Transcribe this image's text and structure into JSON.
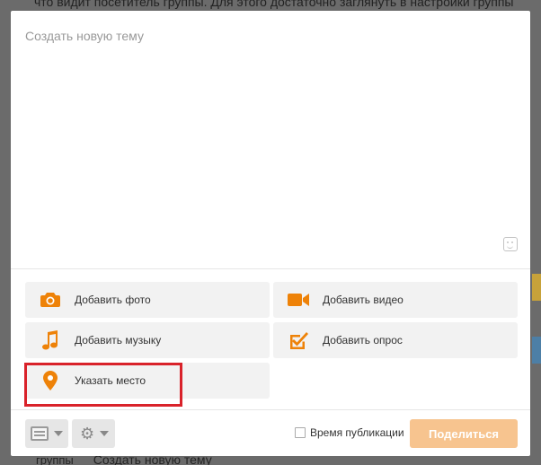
{
  "background": {
    "top_text": "что видит посетитель группы. Для этого достаточно заглянуть в настройки группы",
    "bottom_text_left": "группы",
    "bottom_text_right": "Создать новую тему"
  },
  "editor": {
    "placeholder": "Создать новую тему",
    "emoji_icon": "smile-icon"
  },
  "attachments": [
    {
      "label": "Добавить фото",
      "icon": "camera-icon"
    },
    {
      "label": "Добавить видео",
      "icon": "video-camera-icon"
    },
    {
      "label": "Добавить музыку",
      "icon": "music-note-icon"
    },
    {
      "label": "Добавить опрос",
      "icon": "poll-checkbox-icon"
    },
    {
      "label": "Указать место",
      "icon": "map-pin-icon"
    }
  ],
  "footer": {
    "publish_time_label": "Время публикации",
    "share_label": "Поделиться"
  },
  "colors": {
    "accent": "#ee8208",
    "share_button": "#f7c48f",
    "highlight": "#d9222a",
    "tile_bg": "#f2f2f2"
  }
}
